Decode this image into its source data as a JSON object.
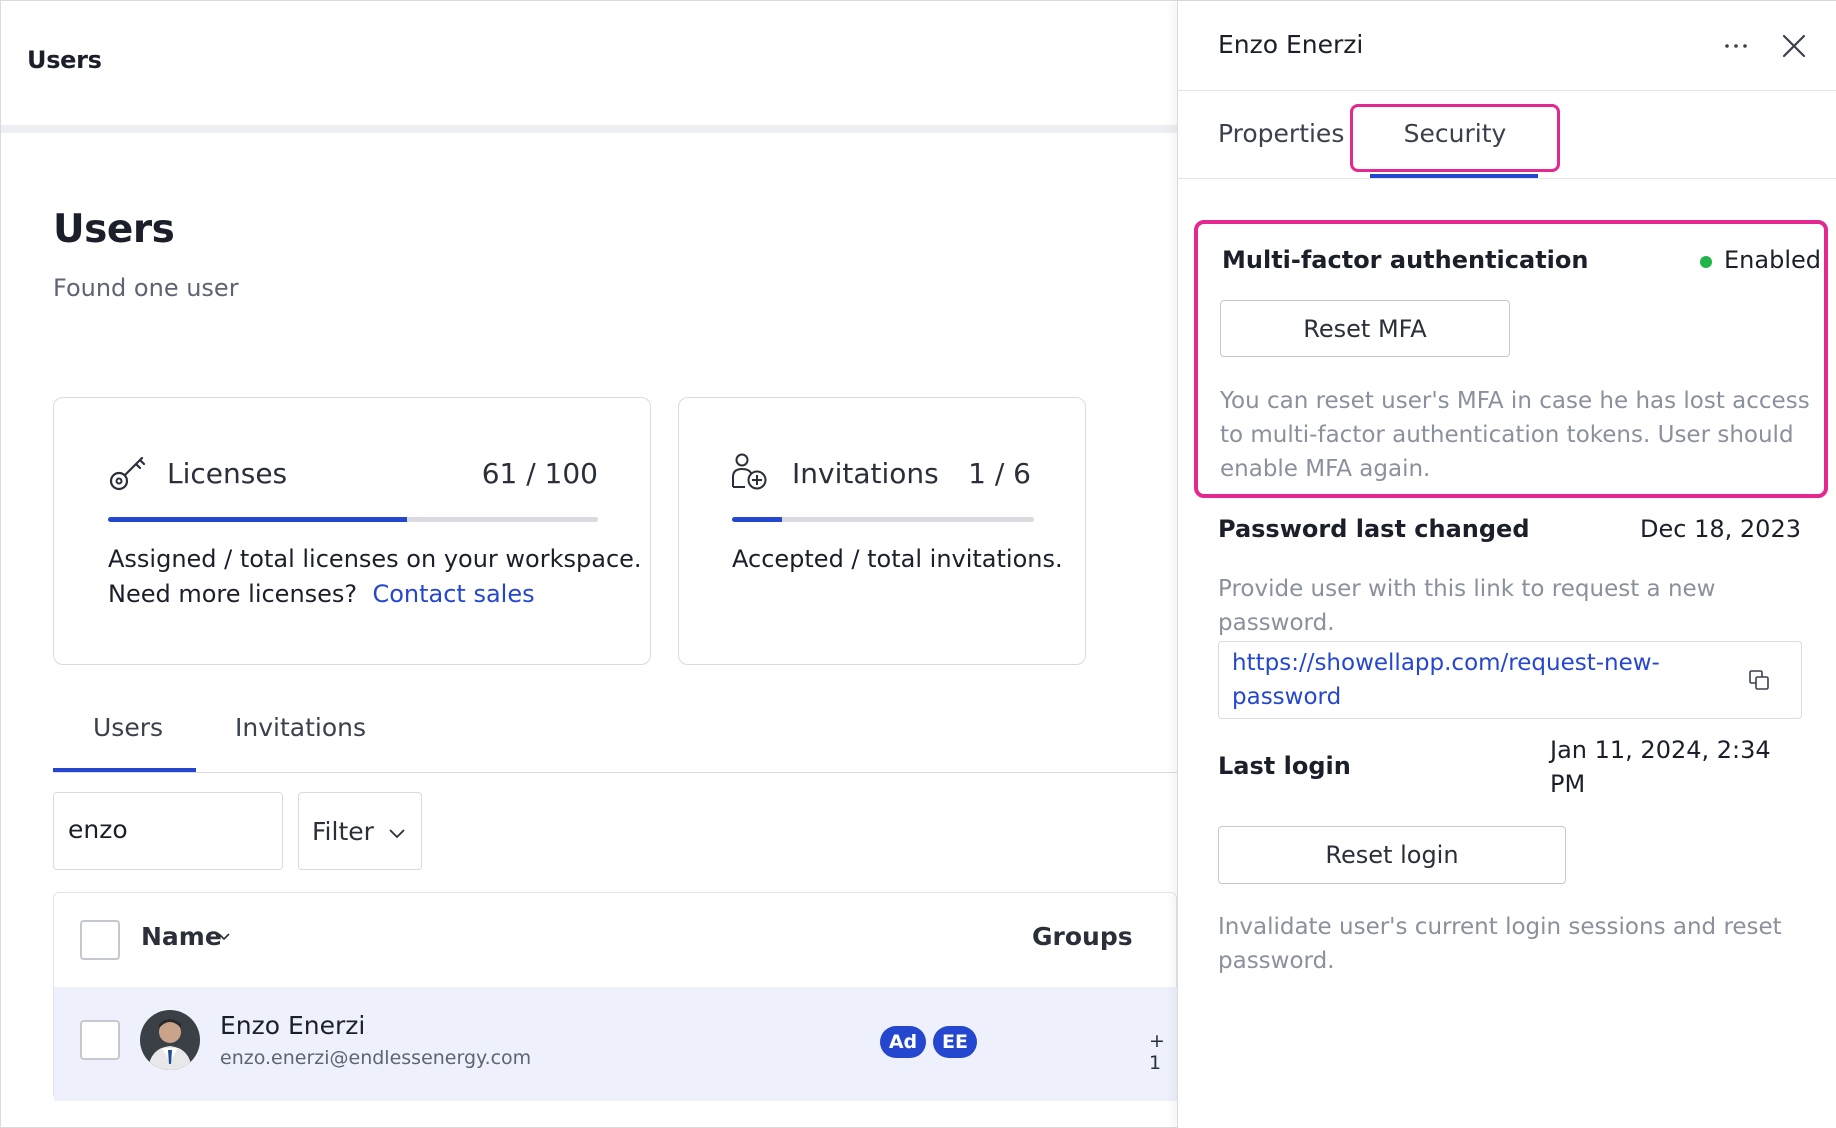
{
  "topbar": {
    "title": "Users"
  },
  "page": {
    "title": "Users",
    "subtitle": "Found one user"
  },
  "licenses": {
    "label": "Licenses",
    "count": "61 / 100",
    "used": 61,
    "total": 100,
    "desc_line1": "Assigned / total licenses on your workspace.",
    "desc_line2": "Need more licenses?",
    "link": "Contact sales"
  },
  "invitations": {
    "label": "Invitations",
    "count": "1 / 6",
    "used": 1,
    "total": 6,
    "desc": "Accepted / total invitations."
  },
  "main_tabs": [
    {
      "label": "Users",
      "active": true
    },
    {
      "label": "Invitations",
      "active": false
    }
  ],
  "search": {
    "value": "enzo"
  },
  "filter": {
    "label": "Filter"
  },
  "table": {
    "columns": {
      "name": "Name",
      "groups": "Groups"
    },
    "rows": [
      {
        "name": "Enzo Enerzi",
        "email": "enzo.enerzi@endlessenergy.com",
        "groups": [
          "Ad",
          "EE"
        ],
        "groups_more": "+ 1"
      }
    ]
  },
  "panel": {
    "title": "Enzo Enerzi",
    "tabs": [
      {
        "label": "Properties",
        "active": false
      },
      {
        "label": "Security",
        "active": true
      }
    ],
    "mfa": {
      "title": "Multi-factor authentication",
      "status": "Enabled",
      "status_color": "#1fb54a",
      "button": "Reset MFA",
      "desc": "You can reset user's MFA in case he has lost access to multi-factor authentication tokens. User should enable MFA again."
    },
    "password": {
      "label": "Password last changed",
      "value": "Dec 18, 2023",
      "desc": "Provide user with this link to request a new password.",
      "link": "https://showellapp.com/request-new-password"
    },
    "login": {
      "label": "Last login",
      "value": "Jan 11, 2024, 2:34 PM",
      "button": "Reset login",
      "desc": "Invalidate user's current login sessions and reset password."
    }
  },
  "colors": {
    "accent": "#2547d0",
    "highlight": "#e3288f",
    "row_selected": "#eef1fb"
  },
  "icons": {
    "licenses": "key-icon",
    "invitations": "user-add-icon",
    "filter": "chevron-down-icon",
    "more": "ellipsis-icon",
    "close": "close-icon",
    "copy": "copy-icon"
  }
}
